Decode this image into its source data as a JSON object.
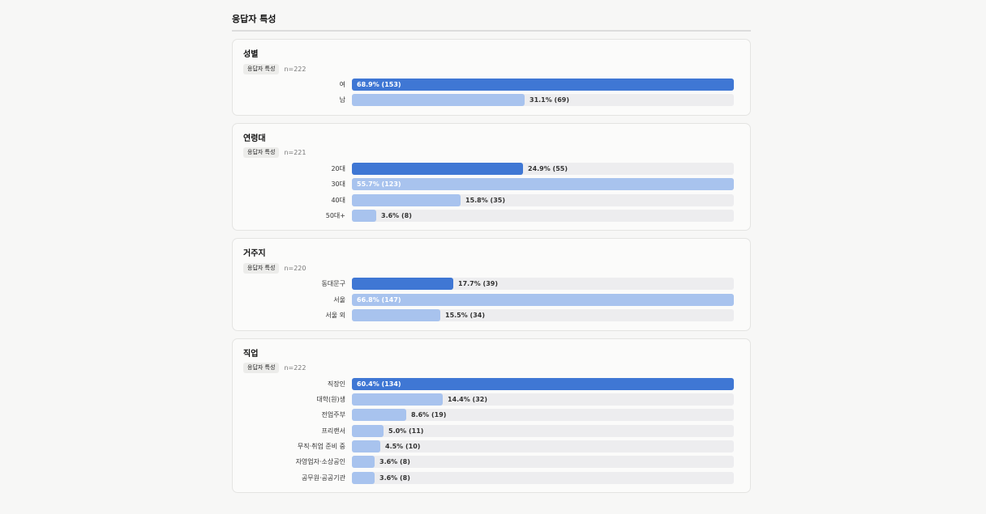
{
  "section_title": "응답자 특성",
  "colors": {
    "primary": "#3f77d4",
    "secondary": "#a8c3ee",
    "track": "#ededef"
  },
  "chart_data": [
    {
      "type": "bar",
      "orientation": "horizontal",
      "title": "성별",
      "tag": "응답자 특성",
      "n_label": "n=222",
      "xlim": [
        0,
        100
      ],
      "categories": [
        "여",
        "남"
      ],
      "values": [
        68.9,
        31.1
      ],
      "counts": [
        153,
        69
      ],
      "labels": [
        "68.9% (153)",
        "31.1% (69)"
      ]
    },
    {
      "type": "bar",
      "orientation": "horizontal",
      "title": "연령대",
      "tag": "응답자 특성",
      "n_label": "n=221",
      "xlim": [
        0,
        100
      ],
      "categories": [
        "20대",
        "30대",
        "40대",
        "50대+"
      ],
      "values": [
        24.9,
        55.7,
        15.8,
        3.6
      ],
      "counts": [
        55,
        123,
        35,
        8
      ],
      "labels": [
        "24.9% (55)",
        "55.7% (123)",
        "15.8% (35)",
        "3.6% (8)"
      ]
    },
    {
      "type": "bar",
      "orientation": "horizontal",
      "title": "거주지",
      "tag": "응답자 특성",
      "n_label": "n=220",
      "xlim": [
        0,
        100
      ],
      "categories": [
        "동대문구",
        "서울",
        "서울 외"
      ],
      "values": [
        17.7,
        66.8,
        15.5
      ],
      "counts": [
        39,
        147,
        34
      ],
      "labels": [
        "17.7% (39)",
        "66.8% (147)",
        "15.5% (34)"
      ]
    },
    {
      "type": "bar",
      "orientation": "horizontal",
      "title": "직업",
      "tag": "응답자 특성",
      "n_label": "n=222",
      "xlim": [
        0,
        100
      ],
      "categories": [
        "직장인",
        "대학(원)생",
        "전업주부",
        "프리랜서",
        "무직·취업 준비 중",
        "자영업자·소상공인",
        "공무원·공공기관"
      ],
      "values": [
        60.4,
        14.4,
        8.6,
        5.0,
        4.5,
        3.6,
        3.6
      ],
      "counts": [
        134,
        32,
        19,
        11,
        10,
        8,
        8
      ],
      "labels": [
        "60.4% (134)",
        "14.4% (32)",
        "8.6% (19)",
        "5.0% (11)",
        "4.5% (10)",
        "3.6% (8)",
        "3.6% (8)"
      ]
    }
  ]
}
